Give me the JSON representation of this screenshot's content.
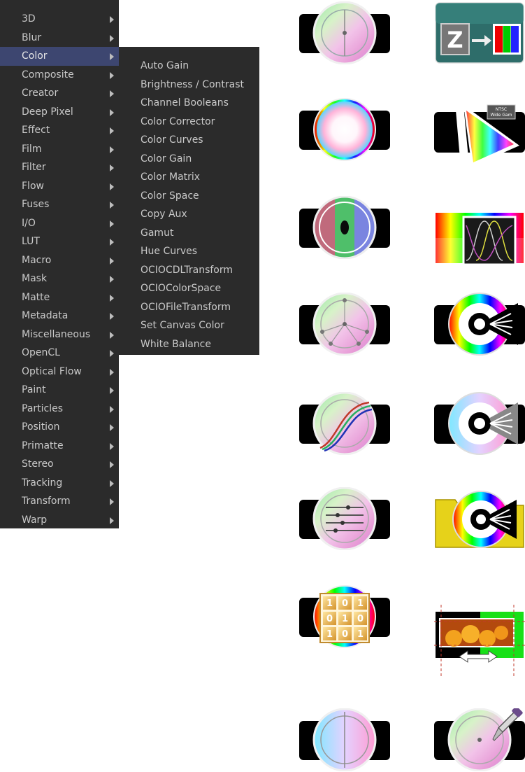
{
  "menu": {
    "items": [
      {
        "label": "3D"
      },
      {
        "label": "Blur"
      },
      {
        "label": "Color"
      },
      {
        "label": "Composite"
      },
      {
        "label": "Creator"
      },
      {
        "label": "Deep Pixel"
      },
      {
        "label": "Effect"
      },
      {
        "label": "Film"
      },
      {
        "label": "Filter"
      },
      {
        "label": "Flow"
      },
      {
        "label": "Fuses"
      },
      {
        "label": "I/O"
      },
      {
        "label": "LUT"
      },
      {
        "label": "Macro"
      },
      {
        "label": "Mask"
      },
      {
        "label": "Matte"
      },
      {
        "label": "Metadata"
      },
      {
        "label": "Miscellaneous"
      },
      {
        "label": "OpenCL"
      },
      {
        "label": "Optical Flow"
      },
      {
        "label": "Paint"
      },
      {
        "label": "Particles"
      },
      {
        "label": "Position"
      },
      {
        "label": "Primatte"
      },
      {
        "label": "Stereo"
      },
      {
        "label": "Tracking"
      },
      {
        "label": "Transform"
      },
      {
        "label": "Warp"
      }
    ],
    "active": "Color"
  },
  "submenu": {
    "items": [
      {
        "label": "Auto Gain"
      },
      {
        "label": "Brightness / Contrast"
      },
      {
        "label": "Channel Booleans"
      },
      {
        "label": "Color Corrector"
      },
      {
        "label": "Color Curves"
      },
      {
        "label": "Color Gain"
      },
      {
        "label": "Color Matrix"
      },
      {
        "label": "Color Space"
      },
      {
        "label": "Copy Aux"
      },
      {
        "label": "Gamut"
      },
      {
        "label": "Hue Curves"
      },
      {
        "label": "OCIOCDLTransform"
      },
      {
        "label": "OCIOColorSpace"
      },
      {
        "label": "OCIOFileTransform"
      },
      {
        "label": "Set Canvas Color"
      },
      {
        "label": "White Balance"
      }
    ]
  },
  "icons": {
    "gamut_badge_line1": "NTSC",
    "gamut_badge_line2": "Wide Gam",
    "matrix_rows": [
      [
        "1",
        "0",
        "1"
      ],
      [
        "0",
        "1",
        "0"
      ],
      [
        "1",
        "0",
        "1"
      ]
    ],
    "copy_aux_letter": "Z"
  },
  "colors": {
    "menu_bg": "#2b2b2b",
    "menu_active": "#3d4670",
    "menu_text": "#c9c9c9"
  }
}
